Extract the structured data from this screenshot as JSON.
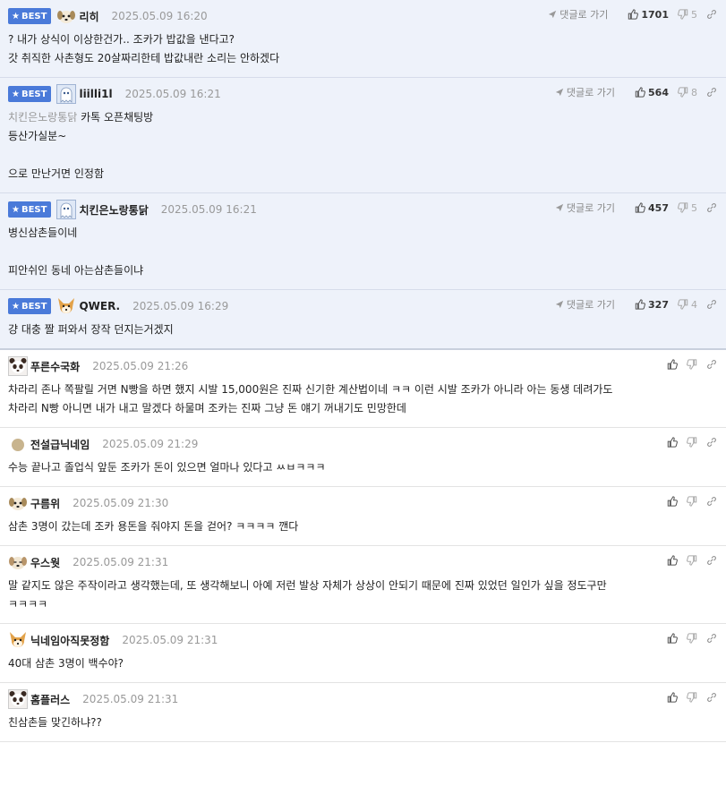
{
  "best_badge": "BEST",
  "reply_label": "댓글로 가기",
  "best_comments": [
    {
      "nick": "리히",
      "date": "2025.05.09 16:20",
      "likes": "1701",
      "dislikes": "5",
      "avatar": "dog-avatar",
      "lines": [
        "? 내가 상식이 이상한건가.. 조카가 밥값을 낸다고?",
        "갓 취직한 사촌형도 20살짜리한테 밥값내란 소리는 안하겠다"
      ]
    },
    {
      "nick": "liilli1l",
      "date": "2025.05.09 16:21",
      "likes": "564",
      "dislikes": "8",
      "avatar": "ghost-avatar",
      "quote": "치킨은노랑통닭",
      "lines": [
        "카톡 오픈채팅방",
        "등산가실분~",
        "",
        "으로 만난거면 인정함"
      ]
    },
    {
      "nick": "치킨은노랑통닭",
      "date": "2025.05.09 16:21",
      "likes": "457",
      "dislikes": "5",
      "avatar": "ghost-avatar",
      "lines": [
        "병신삼촌들이네",
        "",
        "피안쉬인 동네 아는삼촌들이냐"
      ]
    },
    {
      "nick": "QWER.",
      "date": "2025.05.09 16:29",
      "likes": "327",
      "dislikes": "4",
      "avatar": "fox-avatar",
      "lines": [
        "걍 대충 짤 퍼와서 장작 던지는거겠지"
      ]
    }
  ],
  "comments": [
    {
      "nick": "푸른수국화",
      "date": "2025.05.09 21:26",
      "avatar": "panda-avatar",
      "lines": [
        "차라리 존나 쪽팔릴 거면 N빵을 하면 했지 시발 15,000원은 진짜 신기한 계산법이네 ㅋㅋ 이런 시발 조카가 아니라 아는 동생 데려가도",
        "차라리 N빵 아니면 내가 내고 말겠다 하물며 조카는 진짜 그냥 돈 얘기 꺼내기도 민망한데"
      ]
    },
    {
      "nick": "전설급닉네임",
      "date": "2025.05.09 21:29",
      "avatar": "dot-avatar",
      "lines": [
        "수능 끝나고 졸업식 앞둔 조카가 돈이 있으면 얼마나 있다고 ㅆㅂㅋㅋㅋ"
      ]
    },
    {
      "nick": "구름위",
      "date": "2025.05.09 21:30",
      "avatar": "dog-avatar",
      "lines": [
        "삼촌 3명이 갔는데 조카 용돈을 줘야지 돈을 걷어? ㅋㅋㅋㅋ 깬다"
      ]
    },
    {
      "nick": "우스웟",
      "date": "2025.05.09 21:31",
      "avatar": "sleepy-dog-avatar",
      "lines": [
        "말 같지도 않은 주작이라고 생각했는데, 또 생각해보니 아예 저런 발상 자체가 상상이 안되기 때문에 진짜 있었던 일인가 싶을 정도구만",
        "ㅋㅋㅋㅋ"
      ]
    },
    {
      "nick": "닉네임아직못정함",
      "date": "2025.05.09 21:31",
      "avatar": "fox-avatar",
      "lines": [
        "40대 삼촌 3명이 백수야?"
      ]
    },
    {
      "nick": "홈플러스",
      "date": "2025.05.09 21:31",
      "avatar": "panda-avatar",
      "lines": [
        "친삼촌들 맞긴하냐??"
      ]
    }
  ]
}
